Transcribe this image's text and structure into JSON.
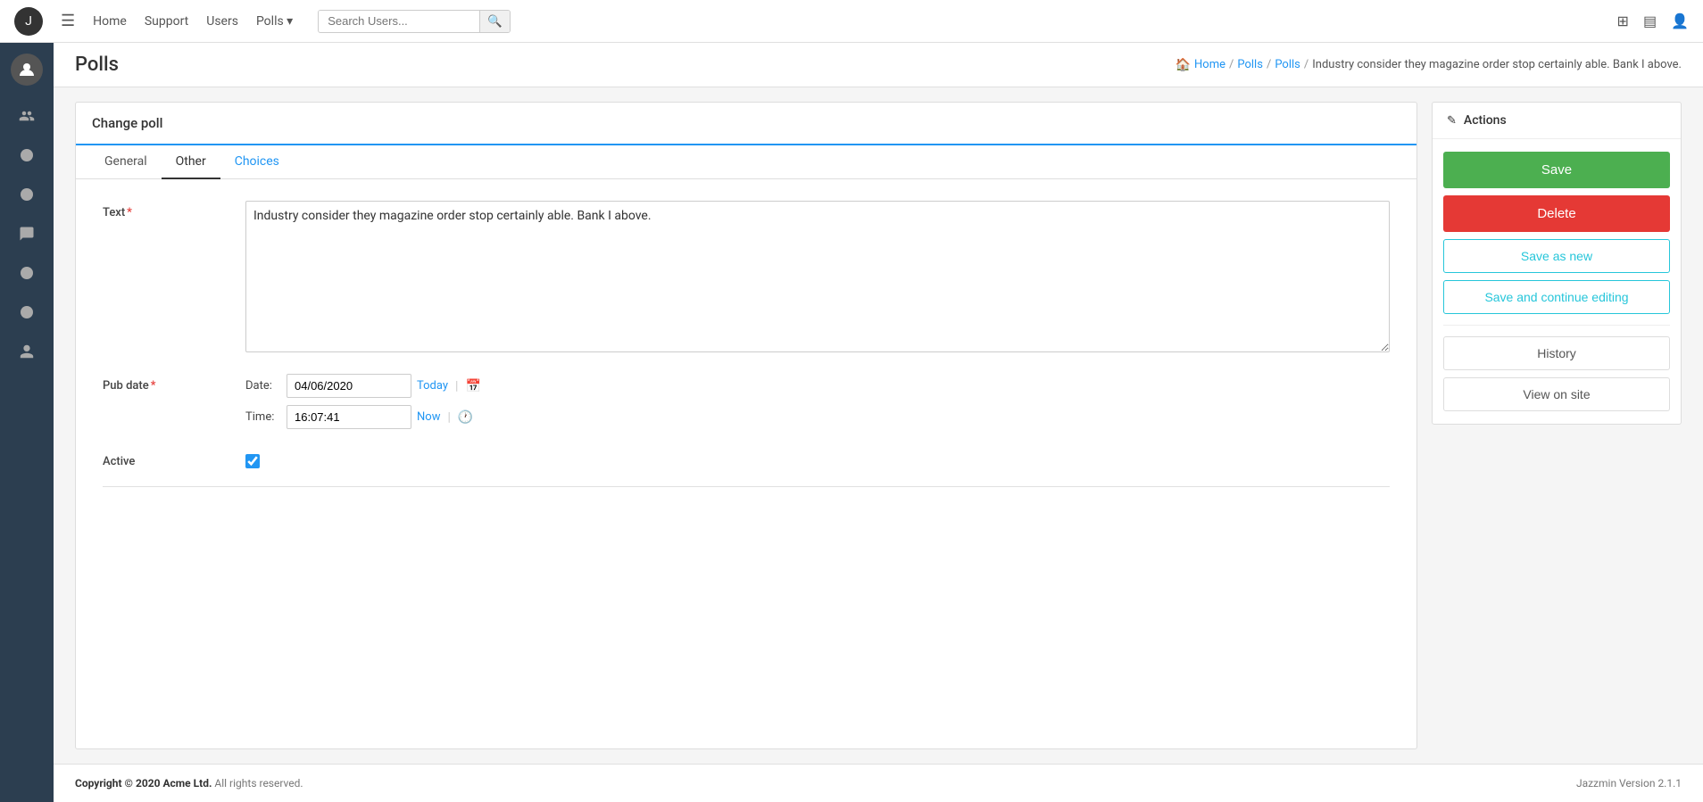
{
  "app": {
    "logo_text": "J"
  },
  "topnav": {
    "hamburger": "☰",
    "links": [
      {
        "label": "Home",
        "name": "home-link"
      },
      {
        "label": "Support",
        "name": "support-link"
      },
      {
        "label": "Users",
        "name": "users-link"
      },
      {
        "label": "Polls ▾",
        "name": "polls-link"
      }
    ],
    "search_placeholder": "Search Users...",
    "icons": [
      "⊞",
      "▤",
      "👤"
    ]
  },
  "sidebar": {
    "icons": [
      "👤",
      "⬤",
      "⬤",
      "💬",
      "⬤",
      "⬤",
      "👤"
    ]
  },
  "breadcrumb": {
    "home": "Home",
    "polls1": "Polls",
    "polls2": "Polls",
    "current": "Industry consider they magazine order stop certainly able. Bank I above."
  },
  "page": {
    "title": "Polls",
    "form_title": "Change poll"
  },
  "tabs": [
    {
      "label": "General",
      "active": false
    },
    {
      "label": "Other",
      "active": true
    },
    {
      "label": "Choices",
      "active": false
    }
  ],
  "form": {
    "text_label": "Text",
    "text_required": "*",
    "text_value": "Industry consider they magazine order stop certainly able. Bank I above.",
    "pub_date_label": "Pub date",
    "pub_date_required": "*",
    "date_label": "Date:",
    "date_value": "04/06/2020",
    "today_link": "Today",
    "time_label": "Time:",
    "time_value": "16:07:41",
    "now_link": "Now",
    "active_label": "Active",
    "active_checked": true
  },
  "actions": {
    "title": "Actions",
    "edit_icon": "✎",
    "save_label": "Save",
    "delete_label": "Delete",
    "save_as_new_label": "Save as new",
    "save_continue_label": "Save and continue editing",
    "history_label": "History",
    "view_on_site_label": "View on site"
  },
  "footer": {
    "copyright": "Copyright © 2020 Acme Ltd.",
    "rights": " All rights reserved.",
    "version_label": "Jazzmin Version",
    "version": "2.1.1"
  }
}
